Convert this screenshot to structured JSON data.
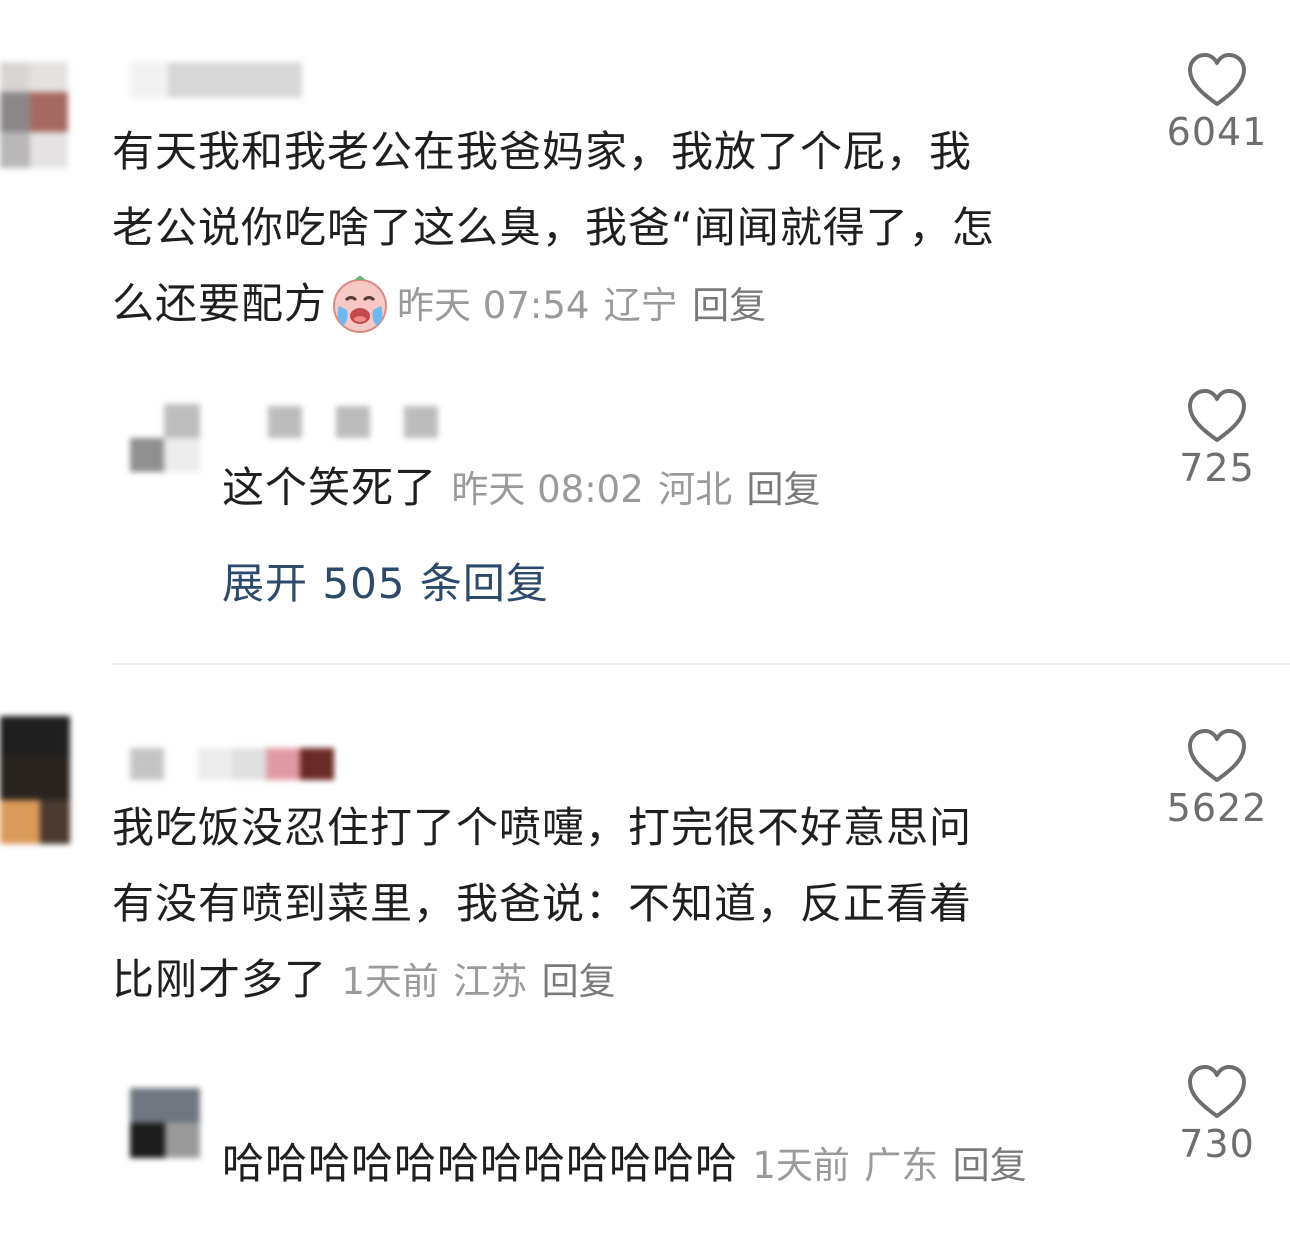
{
  "comments": [
    {
      "text_lines": [
        "有天我和我老公在我爸妈家，我放了个屁，我",
        "老公说你吃啥了这么臭，我爸“闻闻就得了，怎",
        "么还要配方"
      ],
      "emoji": "crying-laughing-emoji",
      "time": "昨天 07:54",
      "location": "辽宁",
      "reply_label": "回复",
      "likes": "6041",
      "replies": [
        {
          "text": "这个笑死了",
          "time": "昨天 08:02",
          "location": "河北",
          "reply_label": "回复",
          "likes": "725"
        }
      ],
      "expand_label": "展开 505 条回复"
    },
    {
      "text_lines": [
        "我吃饭没忍住打了个喷嚏，打完很不好意思问",
        "有没有喷到菜里，我爸说：不知道，反正看着",
        "比刚才多了"
      ],
      "time": "1天前",
      "location": "江苏",
      "reply_label": "回复",
      "likes": "5622",
      "replies": [
        {
          "text": "哈哈哈哈哈哈哈哈哈哈哈哈",
          "time": "1天前",
          "location": "广东",
          "reply_label": "回复",
          "likes": "730"
        }
      ]
    }
  ],
  "icons": {
    "like": "heart-outline-icon"
  },
  "colors": {
    "expand_link": "#2d4a6b",
    "meta": "#9a9a9a"
  }
}
